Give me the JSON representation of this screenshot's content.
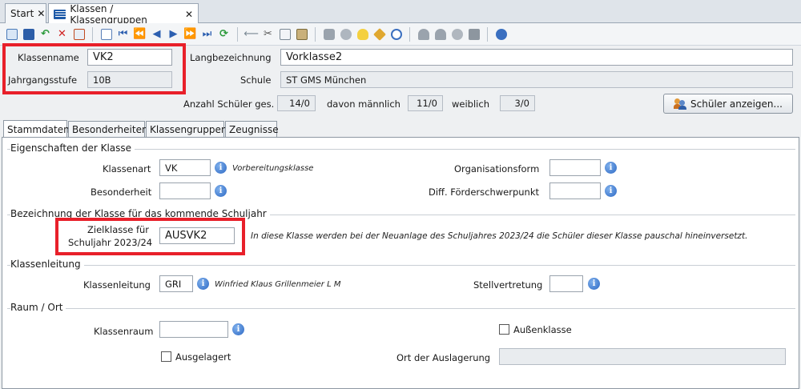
{
  "tabs": {
    "start": "Start",
    "klassen": "Klassen / Klassengruppen",
    "close": "✕"
  },
  "toolbar": {
    "icons": [
      "new-icon",
      "save-icon",
      "undo-icon",
      "delete-icon",
      "export-icon",
      "copy-icon",
      "first-icon",
      "prev-page-icon",
      "prev-icon",
      "next-icon",
      "next-page-icon",
      "last-icon",
      "refresh-icon",
      "back-icon",
      "cut-icon",
      "copy-doc-icon",
      "paste-icon",
      "print-icon",
      "preview-icon",
      "lightbulb-icon",
      "broom-icon",
      "clock-icon",
      "user-group-icon",
      "user-icon",
      "stamp-icon",
      "window-icon",
      "help-icon"
    ]
  },
  "header": {
    "klassenname_label": "Klassenname",
    "klassenname_value": "VK2",
    "jahrgangsstufe_label": "Jahrgangsstufe",
    "jahrgangsstufe_value": "10B",
    "langbezeichnung_label": "Langbezeichnung",
    "langbezeichnung_value": "Vorklasse2",
    "schule_label": "Schule",
    "schule_value": "ST GMS München",
    "anzahl_label": "Anzahl Schüler ges.",
    "anzahl_value": "14/0",
    "maennlich_label": "davon männlich",
    "maennlich_value": "11/0",
    "weiblich_label": "weiblich",
    "weiblich_value": "3/0",
    "show_students_button": "Schüler anzeigen..."
  },
  "inner_tabs": [
    "Stammdaten",
    "Besonderheiten",
    "Klassengruppen",
    "Zeugnisse"
  ],
  "eigenschaften": {
    "title": "Eigenschaften der Klasse",
    "klassenart_label": "Klassenart",
    "klassenart_value": "VK",
    "klassenart_note": "Vorbereitungsklasse",
    "besonderheit_label": "Besonderheit",
    "besonderheit_value": "",
    "organisationsform_label": "Organisationsform",
    "organisationsform_value": "",
    "foerder_label": "Diff. Förderschwerpunkt",
    "foerder_value": ""
  },
  "bezeichnung": {
    "title": "Bezeichnung der Klasse für das kommende Schuljahr",
    "zielklasse_label_1": "Zielklasse für",
    "zielklasse_label_2": "Schuljahr 2023/24",
    "zielklasse_value": "AUSVK2",
    "note": "In diese Klasse werden bei der Neuanlage des Schuljahres 2023/24 die Schüler dieser Klasse pauschal hineinversetzt."
  },
  "klassenleitung": {
    "title": "Klassenleitung",
    "label": "Klassenleitung",
    "value": "GRI",
    "name": "Winfried Klaus Grillenmeier L M",
    "stellvertretung_label": "Stellvertretung",
    "stellvertretung_value": ""
  },
  "raum": {
    "title": "Raum / Ort",
    "klassenraum_label": "Klassenraum",
    "klassenraum_value": "",
    "aussenklasse_label": "Außenklasse",
    "ausgelagert_label": "Ausgelagert",
    "ort_label": "Ort der Auslagerung",
    "ort_value": ""
  },
  "info_glyph": "i",
  "colors": {
    "highlight": "#e8202a",
    "accent": "#2c68c4"
  }
}
